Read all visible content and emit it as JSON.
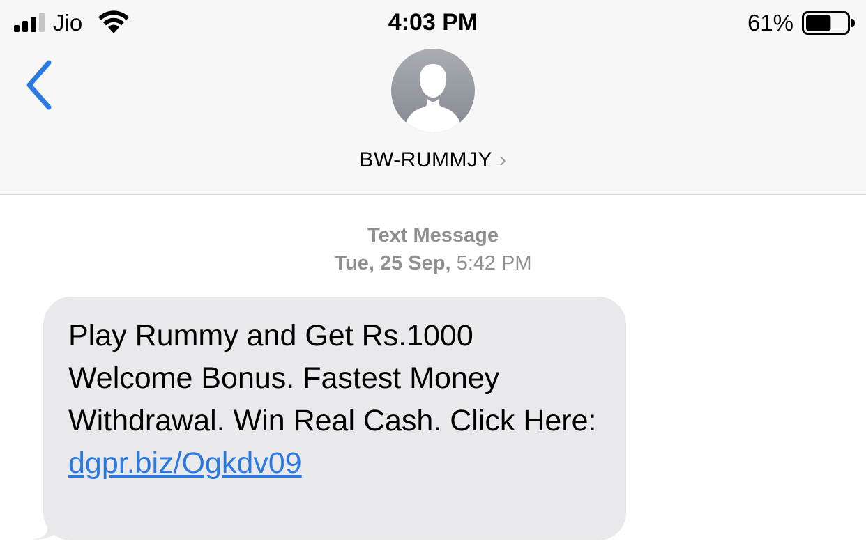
{
  "status_bar": {
    "carrier": "Jio",
    "time": "4:03 PM",
    "battery_percent": "61%",
    "battery_level": 0.61,
    "signal_bars": 3,
    "icons": [
      "signal-icon",
      "wifi-icon",
      "battery-icon"
    ]
  },
  "nav": {
    "back_icon": "chevron-left-icon",
    "contact_name": "BW-RUMMJY",
    "contact_chevron": "›",
    "avatar_icon": "person-silhouette-icon"
  },
  "conversation": {
    "message_type": "Text Message",
    "date_day": "Tue, 25 Sep,",
    "date_time": "5:42 PM",
    "messages": [
      {
        "direction": "incoming",
        "text": "Play Rummy and Get Rs.1000 Welcome Bonus. Fastest Money Withdrawal. Win Real Cash. Click Here:",
        "link": "dgpr.biz/Ogkdv09"
      }
    ]
  },
  "colors": {
    "accent": "#2a7ae2",
    "bubble_incoming": "#e9e9eb",
    "header_bg": "#f7f7f7",
    "meta_text": "#8e8e93"
  }
}
